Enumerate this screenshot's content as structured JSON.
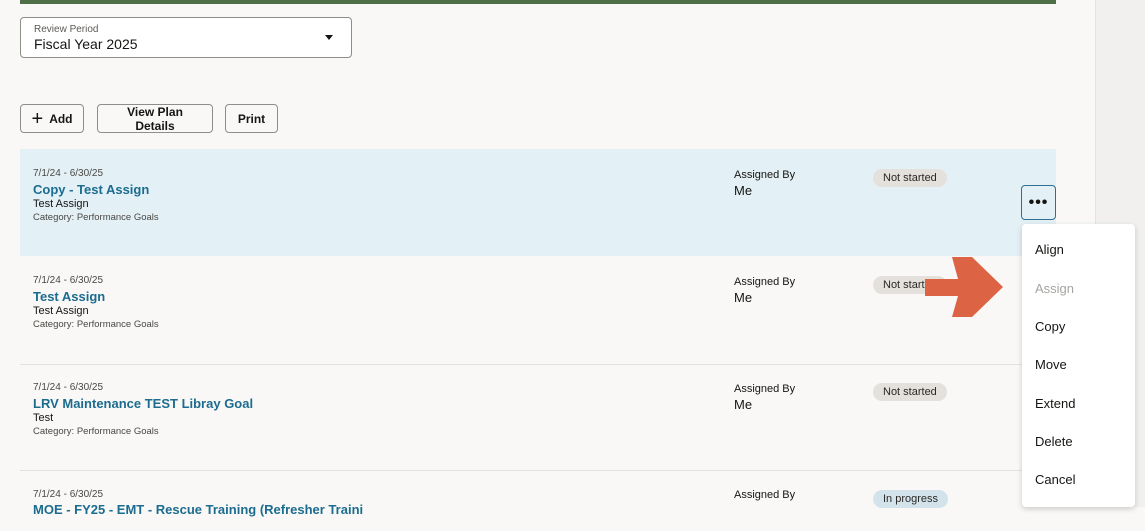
{
  "review_period": {
    "label": "Review Period",
    "value": "Fiscal Year 2025"
  },
  "toolbar": {
    "add": "Add",
    "view_plan": "View Plan Details",
    "print": "Print"
  },
  "goals": [
    {
      "date": "7/1/24 - 6/30/25",
      "title": "Copy - Test Assign",
      "subtitle": "Test Assign",
      "category": "Category: Performance Goals",
      "assigned_by_label": "Assigned By",
      "assigned_by": "Me",
      "status": "Not started"
    },
    {
      "date": "7/1/24 - 6/30/25",
      "title": "Test Assign",
      "subtitle": "Test Assign",
      "category": "Category: Performance Goals",
      "assigned_by_label": "Assigned By",
      "assigned_by": "Me",
      "status": "Not started"
    },
    {
      "date": "7/1/24 - 6/30/25",
      "title": "LRV Maintenance TEST Libray Goal",
      "subtitle": "Test",
      "category": "Category: Performance Goals",
      "assigned_by_label": "Assigned By",
      "assigned_by": "Me",
      "status": "Not started"
    },
    {
      "date": "7/1/24 - 6/30/25",
      "title": "MOE - FY25 - EMT - Rescue Training (Refresher Traini",
      "assigned_by_label": "Assigned By",
      "status": "In progress"
    }
  ],
  "more_button": "•••",
  "menu": {
    "items": [
      "Align",
      "Assign",
      "Copy",
      "Move",
      "Extend",
      "Delete",
      "Cancel"
    ],
    "disabled": [
      "Assign"
    ]
  },
  "colors": {
    "accent": "#1b6c8f",
    "arrow": "#dc6445",
    "selected_row": "#e3f0f6"
  }
}
